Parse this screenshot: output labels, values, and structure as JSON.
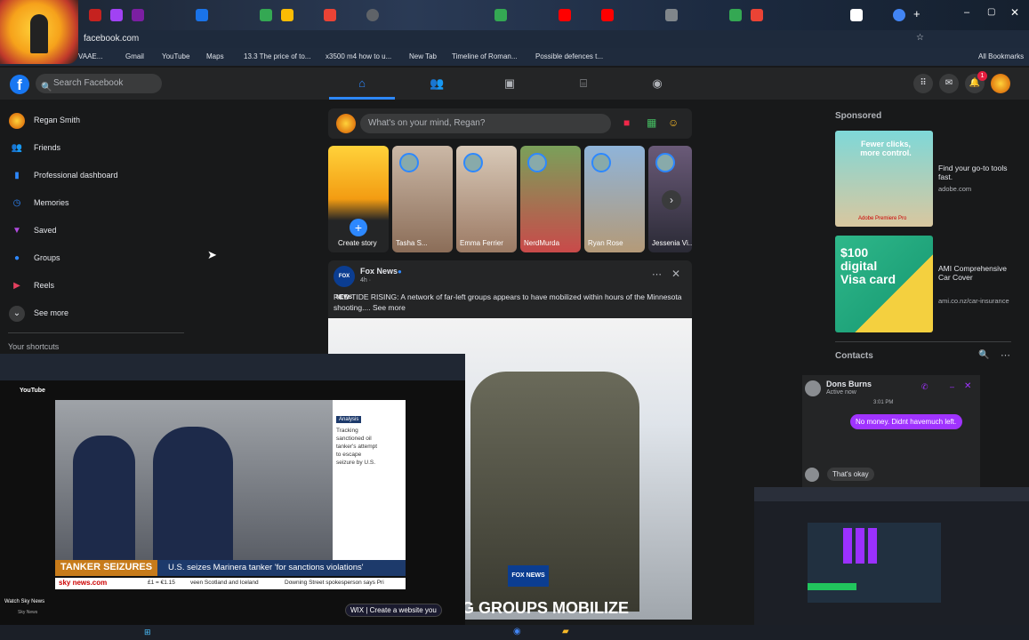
{
  "browser": {
    "url": "facebook.com",
    "bookmarks": [
      "VAAE...",
      "Gmail",
      "YouTube",
      "Maps",
      "13.3 The price of to...",
      "x3500 m4 how to u...",
      "New Tab",
      "Timeline of Roman...",
      "Possible defences t...",
      "All Bookmarks"
    ]
  },
  "header": {
    "search_placeholder": "Search Facebook",
    "notif_count": "1"
  },
  "left_nav": {
    "items": [
      {
        "label": "Regan Smith",
        "icon": "avatar-icon"
      },
      {
        "label": "Friends",
        "icon": "friends-icon"
      },
      {
        "label": "Professional dashboard",
        "icon": "dashboard-icon"
      },
      {
        "label": "Memories",
        "icon": "clock-icon"
      },
      {
        "label": "Saved",
        "icon": "bookmark-icon"
      },
      {
        "label": "Groups",
        "icon": "groups-icon"
      },
      {
        "label": "Reels",
        "icon": "reels-icon"
      },
      {
        "label": "See more",
        "icon": "chevron-down-icon"
      }
    ],
    "shortcuts_title": "Your shortcuts"
  },
  "composer": {
    "placeholder": "What's on your mind, Regan?"
  },
  "stories": [
    "Create story",
    "Tasha S...",
    "Emma Ferrier",
    "NerdMurda",
    "Ryan Rose",
    "Jessenia Vi..."
  ],
  "post": {
    "author": "Fox News",
    "meta": "4h · ",
    "text": "RED TIDE RISING: A network of far-left groups appears to have mobilized within hours of the Minnesota shooting.... See more",
    "image_caption": "G GROUPS MOBILIZE",
    "image_logo": "FOX NEWS"
  },
  "sponsored": {
    "title": "Sponsored",
    "ads": [
      {
        "headline": "Find your go-to tools fast.",
        "domain": "adobe.com",
        "img_text": "Fewer clicks, more control.",
        "brand": "Adobe Premiere Pro"
      },
      {
        "headline": "AMI Comprehensive Car Cover",
        "domain": "ami.co.nz/car-insurance",
        "img_text": "$100 digital Visa card"
      }
    ]
  },
  "contacts": {
    "title": "Contacts"
  },
  "chat": {
    "name": "Dons Burns",
    "status": "Active now",
    "time": "3:01 PM",
    "outgoing": "No money. Didnt havemuch left.",
    "incoming": "That's okay"
  },
  "youtube_overlay": {
    "logo": "YouTube",
    "side_tag": "Analysis",
    "side_text": "Tracking sanctioned oil tanker's attempt to escape seizure by U.S.",
    "lower_third_tag": "TANKER SEIZURES",
    "lower_third_text": "U.S. seizes Marinera tanker 'for sanctions violations'",
    "ticker_brand": "sky news.com",
    "ticker_1": "£1 = €1.15",
    "ticker_2": "veen Scotland and Iceland",
    "ticker_3": "Downing Street spokesperson says Pri",
    "channel_title": "Watch Sky News",
    "channel_name": "Sky News",
    "ad_text": "WIX | Create a website you"
  },
  "colors": {
    "accent": "#2d88ff",
    "fb_blue": "#1877f2",
    "bg": "#18191a",
    "card": "#242526",
    "chat_bubble": "#a033ff",
    "ticker_red": "#d0021b"
  }
}
